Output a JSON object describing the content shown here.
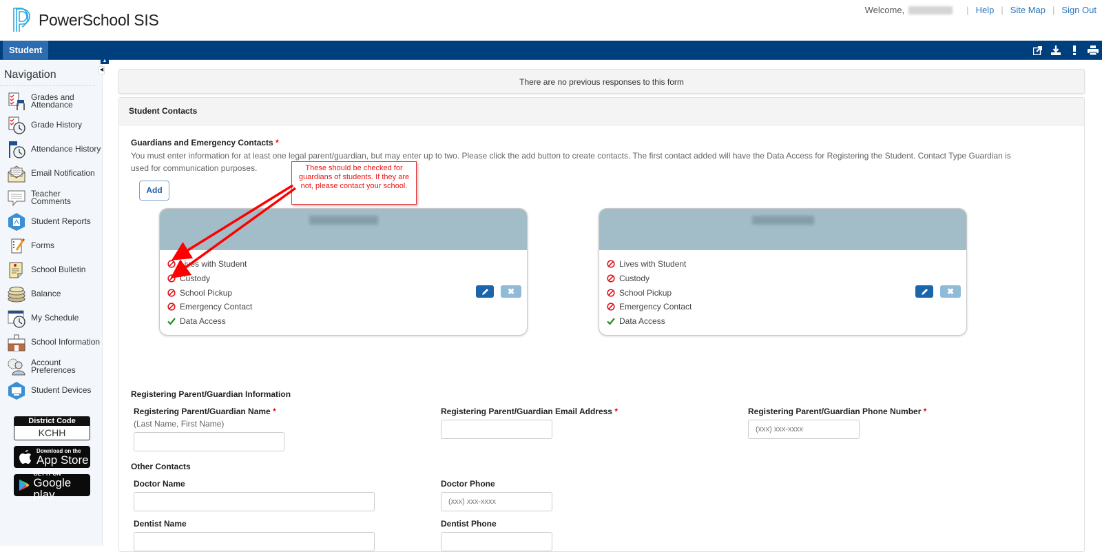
{
  "header": {
    "app_title": "PowerSchool SIS",
    "welcome": "Welcome,",
    "links": [
      "Help",
      "Site Map",
      "Sign Out"
    ]
  },
  "navbar": {
    "tab": "Student",
    "tools": [
      "external-link-icon",
      "download-icon",
      "alert-icon",
      "print-icon"
    ]
  },
  "sidebar": {
    "title": "Navigation",
    "items": [
      {
        "label": "Grades and Attendance",
        "icon": "grades-attendance-icon"
      },
      {
        "label": "Grade History",
        "icon": "grade-history-icon"
      },
      {
        "label": "Attendance History",
        "icon": "attendance-history-icon"
      },
      {
        "label": "Email Notification",
        "icon": "email-icon"
      },
      {
        "label": "Teacher Comments",
        "icon": "comment-icon"
      },
      {
        "label": "Student Reports",
        "icon": "reports-icon"
      },
      {
        "label": "Forms",
        "icon": "forms-icon"
      },
      {
        "label": "School Bulletin",
        "icon": "bulletin-icon"
      },
      {
        "label": "Balance",
        "icon": "coins-icon"
      },
      {
        "label": "My Schedule",
        "icon": "schedule-icon"
      },
      {
        "label": "School Information",
        "icon": "school-icon"
      },
      {
        "label": "Account Preferences",
        "icon": "account-icon"
      },
      {
        "label": "Student Devices",
        "icon": "devices-icon"
      }
    ],
    "district_code_label": "District Code",
    "district_code": "KCHH",
    "app_store": {
      "small": "Download on the",
      "big": "App Store"
    },
    "google_play": {
      "small": "GET IT ON",
      "big": "Google play"
    }
  },
  "main": {
    "notice": "There are no previous responses to this form",
    "panel_title": "Student Contacts",
    "guardians_title": "Guardians and Emergency Contacts",
    "required_mark": "*",
    "guardians_desc": "You must enter information for at least one legal parent/guardian, but may enter up to two. Please click the add button to create contacts. The first contact added will have the Data Access for Registering the Student. Contact Type Guardian is used for communication purposes.",
    "add_label": "Add",
    "callout": "These should be checked for guardians of students. If they are not, please contact your school.",
    "contacts": [
      {
        "name_blurred": true,
        "attributes": [
          {
            "label": "Lives with Student",
            "status": "no"
          },
          {
            "label": "Custody",
            "status": "no"
          },
          {
            "label": "School Pickup",
            "status": "no"
          },
          {
            "label": "Emergency Contact",
            "status": "no"
          },
          {
            "label": "Data Access",
            "status": "yes"
          }
        ]
      },
      {
        "name_blurred": true,
        "attributes": [
          {
            "label": "Lives with Student",
            "status": "no"
          },
          {
            "label": "Custody",
            "status": "no"
          },
          {
            "label": "School Pickup",
            "status": "no"
          },
          {
            "label": "Emergency Contact",
            "status": "no"
          },
          {
            "label": "Data Access",
            "status": "yes"
          }
        ]
      }
    ],
    "registering": {
      "title": "Registering Parent/Guardian Information",
      "name_label": "Registering Parent/Guardian Name",
      "name_hint": "(Last Name, First Name)",
      "name_value": "",
      "email_label": "Registering Parent/Guardian Email Address",
      "email_value": "",
      "phone_label": "Registering Parent/Guardian Phone Number",
      "phone_placeholder": "(xxx) xxx-xxxx"
    },
    "other_contacts": {
      "title": "Other Contacts",
      "doctor_name_label": "Doctor Name",
      "doctor_phone_label": "Doctor Phone",
      "doctor_phone_placeholder": "(xxx) xxx-xxxx",
      "dentist_name_label": "Dentist Name",
      "dentist_phone_label": "Dentist Phone"
    }
  },
  "colors": {
    "brand_blue": "#003f7e",
    "tab_blue": "#2c6cb0",
    "card_header": "#a3bdc8",
    "no_red": "#e0141e",
    "yes_green": "#1e8a1e",
    "annotation_red": "#ff0000"
  }
}
